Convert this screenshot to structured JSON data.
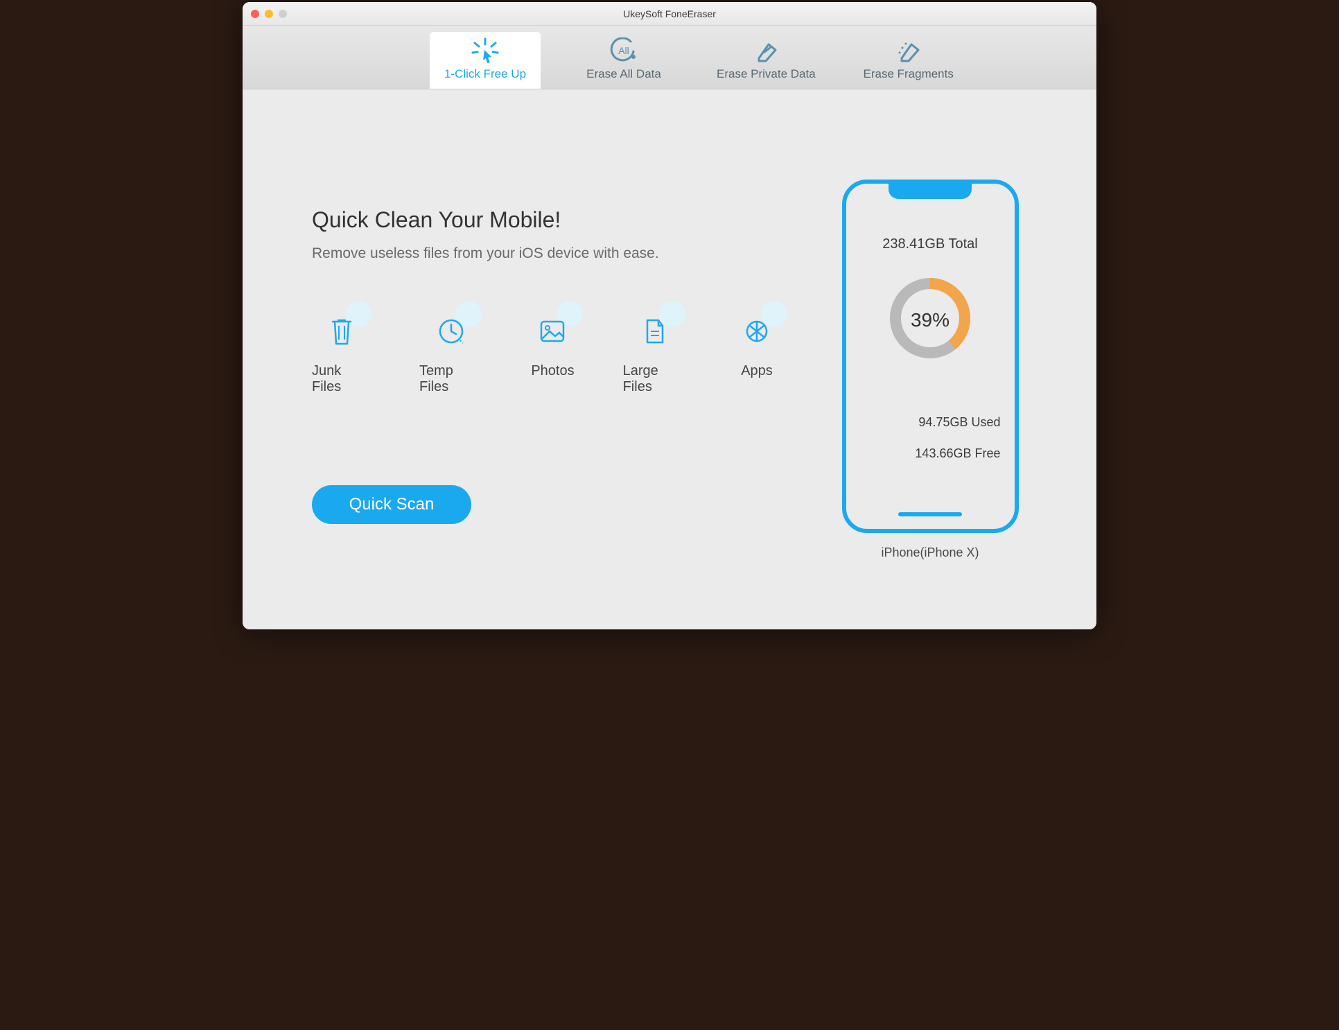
{
  "window": {
    "title": "UkeySoft FoneEraser"
  },
  "tabs": [
    {
      "label": "1-Click Free Up",
      "active": true
    },
    {
      "label": "Erase All Data"
    },
    {
      "label": "Erase Private Data"
    },
    {
      "label": "Erase Fragments"
    }
  ],
  "main": {
    "heading": "Quick Clean Your Mobile!",
    "subheading": "Remove useless files from your iOS device with ease.",
    "categories": [
      {
        "label": "Junk Files"
      },
      {
        "label": "Temp Files"
      },
      {
        "label": "Photos"
      },
      {
        "label": "Large Files"
      },
      {
        "label": "Apps"
      }
    ],
    "scan_button": "Quick Scan"
  },
  "device": {
    "total_label": "238.41GB Total",
    "used_label": "94.75GB Used",
    "free_label": "143.66GB Free",
    "percent_label": "39%",
    "name": "iPhone(iPhone X)"
  },
  "chart_data": {
    "type": "pie",
    "title": "Storage Usage",
    "values": [
      {
        "name": "Used",
        "value": 94.75,
        "percent": 39,
        "color": "#f2a54a"
      },
      {
        "name": "Free",
        "value": 143.66,
        "percent": 61,
        "color": "#b9b9b9"
      }
    ],
    "total_gb": 238.41,
    "unit": "GB"
  }
}
